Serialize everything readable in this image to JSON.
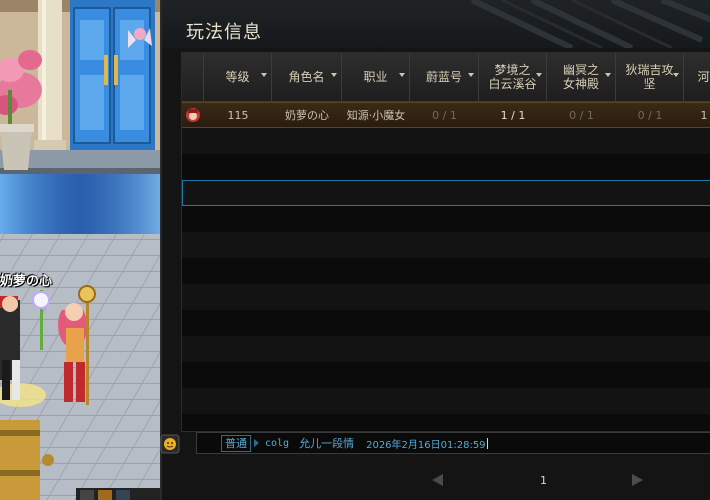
{
  "player": {
    "name": "奶萝の心"
  },
  "panel": {
    "title": "玩法信息",
    "columns": [
      {
        "label": "",
        "sortable": false
      },
      {
        "label": "等级",
        "sortable": true
      },
      {
        "label": "角色名",
        "sortable": true
      },
      {
        "label": "职业",
        "sortable": true
      },
      {
        "label": "蔚蓝号",
        "sortable": true
      },
      {
        "label": "梦境之\n白云溪谷",
        "sortable": true
      },
      {
        "label": "幽冥之\n女神殿",
        "sortable": true
      },
      {
        "label": "狄瑞吉攻\n坚",
        "sortable": true
      },
      {
        "label": "河",
        "sortable": false
      }
    ],
    "rows": [
      {
        "level": "115",
        "name": "奶萝の心",
        "job": "知源·小魔女",
        "c1": "0 / 1",
        "c2": "1 / 1",
        "c3": "0 / 1",
        "c4": "0 / 1",
        "c5": "1"
      }
    ]
  },
  "chat": {
    "channel": "普通",
    "sender": "colg",
    "message": "允儿一段情",
    "timestamp": "2026年2月16日01:28:59"
  },
  "pager": {
    "page": "1"
  },
  "colors": {
    "accent": "#58a9d6",
    "selected_row": "#3b2a17",
    "focus_outline": "#1c7aa8"
  }
}
